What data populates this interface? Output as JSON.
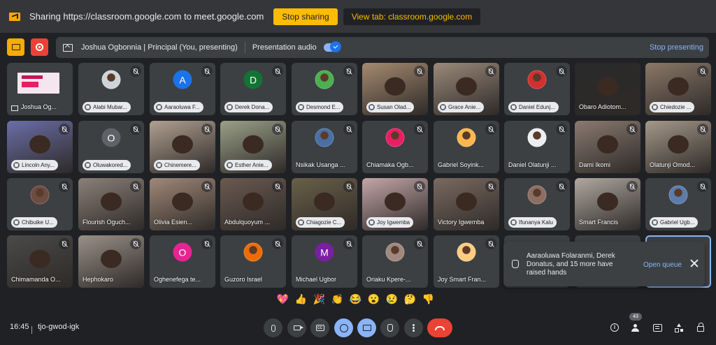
{
  "sharebar": {
    "text": "Sharing https://classroom.google.com to meet.google.com",
    "stop_sharing": "Stop sharing",
    "view_tab": "View tab: classroom.google.com"
  },
  "presbar": {
    "presenter": "Joshua Ogbonnia | Principal (You, presenting)",
    "audio_label": "Presentation audio",
    "audio_on": true,
    "stop_presenting": "Stop presenting"
  },
  "participants": [
    {
      "name": "Joshua Og...",
      "type": "self"
    },
    {
      "name": "Alabi Mubar...",
      "type": "photo",
      "color": "#d0d4d8"
    },
    {
      "name": "Aaraoluwa F...",
      "type": "initial",
      "initial": "A",
      "color": "#1a73e8"
    },
    {
      "name": "Derek Dona...",
      "type": "initial",
      "initial": "D",
      "color": "#137333"
    },
    {
      "name": "Desmond E...",
      "type": "photo",
      "color": "#4caf50"
    },
    {
      "name": "Susan Olad...",
      "type": "cam",
      "color": "#a58a70"
    },
    {
      "name": "Grace Anie...",
      "type": "cam",
      "color": "#9a8a7a"
    },
    {
      "name": "Daniel Edunj...",
      "type": "photo",
      "color": "#d32f2f"
    },
    {
      "name": "Obaro Adiotom...",
      "type": "camplain",
      "color": "#2a2a2a"
    },
    {
      "name": "Chiedozie ...",
      "type": "cam",
      "color": "#8a7868"
    },
    {
      "name": "Lincoln Any...",
      "type": "cam",
      "color": "#6a6ea8"
    },
    {
      "name": "Oluwakored...",
      "type": "initial",
      "initial": "O",
      "color": "#5f6368"
    },
    {
      "name": "Chinemere...",
      "type": "cam",
      "color": "#b0a090"
    },
    {
      "name": "Esther Anie...",
      "type": "cam",
      "color": "#9aa088"
    },
    {
      "name": "Nsikak Usanga ...",
      "type": "photoplain",
      "color": "#4a6fa5"
    },
    {
      "name": "Chiamaka Ogb...",
      "type": "photoplain",
      "color": "#e91e63"
    },
    {
      "name": "Gabriel Soyink...",
      "type": "photoplain",
      "color": "#ffb74d"
    },
    {
      "name": "Daniel Olatunji ...",
      "type": "photoplain",
      "color": "#eceff1"
    },
    {
      "name": "Dami Ikomi",
      "type": "camplain",
      "color": "#8a7a70"
    },
    {
      "name": "Olatunji Omod...",
      "type": "camplain",
      "color": "#a49888"
    },
    {
      "name": "Chibuike U...",
      "type": "photo",
      "color": "#6d4c41"
    },
    {
      "name": "Flourish Oguch...",
      "type": "camplain",
      "color": "#8a8078"
    },
    {
      "name": "Olivia Esien...",
      "type": "camplain",
      "color": "#a08878"
    },
    {
      "name": "Abdulquoyum ...",
      "type": "camplain",
      "color": "#6a5a50"
    },
    {
      "name": "Chiagozie C...",
      "type": "cam",
      "color": "#6a6048"
    },
    {
      "name": "Joy Igwemba",
      "type": "cam",
      "color": "#c4a6a8"
    },
    {
      "name": "Victory Igwemba",
      "type": "camplain",
      "color": "#7a6a60"
    },
    {
      "name": "Ifunanya Kalu",
      "type": "photo",
      "color": "#8d6e63"
    },
    {
      "name": "Smart Francis",
      "type": "camplain",
      "color": "#b0a8a0"
    },
    {
      "name": "Gabriel Ugb...",
      "type": "photo",
      "color": "#5c7cab"
    },
    {
      "name": "Chimamanda O...",
      "type": "camplain",
      "color": "#4a4a48"
    },
    {
      "name": "Hephokaro",
      "type": "camplain",
      "color": "#9a9088"
    },
    {
      "name": "Oghenefega te...",
      "type": "initialplain",
      "initial": "O",
      "color": "#e52592"
    },
    {
      "name": "Guzoro Israel",
      "type": "photoplain",
      "color": "#ef6c00"
    },
    {
      "name": "Michael Ugbor",
      "type": "initialplain",
      "initial": "M",
      "color": "#7b1fa2"
    },
    {
      "name": "Oriaku Kpere-...",
      "type": "photoplain",
      "color": "#a1887f"
    },
    {
      "name": "Joy Smart Fran...",
      "type": "photoplain",
      "color": "#ffcc80"
    }
  ],
  "toast": {
    "message": "Aaraoluwa Folaranmi, Derek Donatus, and 15 more have raised hands",
    "action": "Open queue"
  },
  "reactions": [
    "💖",
    "👍",
    "🎉",
    "👏",
    "😂",
    "😮",
    "😢",
    "🤔",
    "👎"
  ],
  "bottom": {
    "time": "16:45",
    "meeting_code": "tjo-gwod-igk",
    "participant_count": "43"
  },
  "colors": {
    "background": "#202124",
    "tile": "#3c4043",
    "accent_yellow": "#fbbc04",
    "accent_blue": "#8ab4f8",
    "hangup_red": "#ea4335"
  }
}
